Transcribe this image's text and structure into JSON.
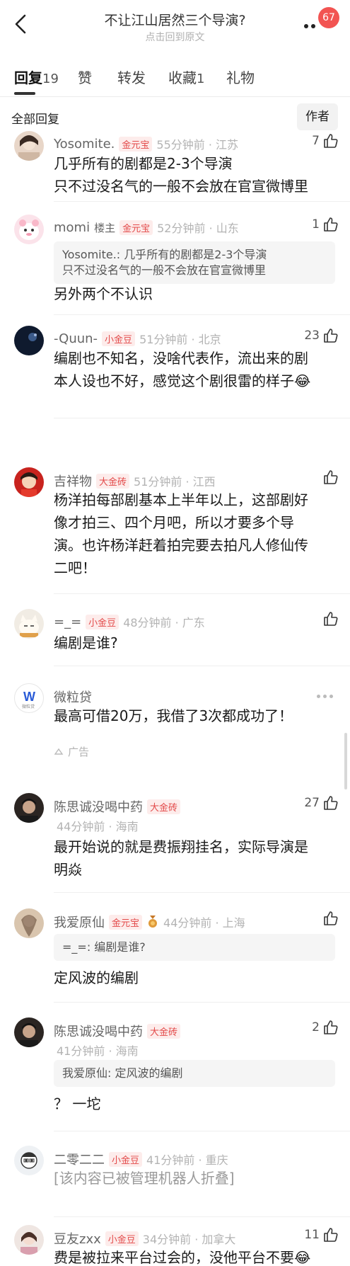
{
  "header": {
    "title": "不让江山居然三个导演?",
    "subtitle": "点击回到原文",
    "badge": "67",
    "back_icon": "chevron-left-icon",
    "more_icon": "more-dots-icon"
  },
  "tabs": [
    {
      "label": "回复",
      "count": "19"
    },
    {
      "label": "赞",
      "count": ""
    },
    {
      "label": "转发",
      "count": ""
    },
    {
      "label": "收藏",
      "count": "1"
    },
    {
      "label": "礼物",
      "count": ""
    }
  ],
  "filter": {
    "label": "全部回复",
    "author_button": "作者"
  },
  "comments": [
    {
      "user": "Yosomite.",
      "tag": "金元宝",
      "time": "55分钟前 · 江苏",
      "likes": "7",
      "text": "几乎所有的剧都是2-3个导演\n只不过没名气的一般不会放在官宣微博里"
    },
    {
      "user": "momi",
      "host": "楼主",
      "tag": "金元宝",
      "time": "52分钟前 · 山东",
      "likes": "1",
      "quote": "Yosomite.: 几乎所有的剧都是2-3个导演\n只不过没名气的一般不会放在官宣微博里",
      "text": "另外两个不认识"
    },
    {
      "user": "-Quun-",
      "tag": "小金豆",
      "time": "51分钟前 · 北京",
      "likes": "23",
      "text": "编剧也不知名，没啥代表作，流出来的剧\n本人设也不好，感觉这个剧很雷的样子😂"
    },
    {
      "user": "吉祥物",
      "tag": "大金砖",
      "time": "51分钟前 · 江西",
      "likes": "",
      "text": "杨洋拍每部剧基本上半年以上，这部剧好\n像才拍三、四个月吧，所以才要多个导\n演。也许杨洋赶着拍完要去拍凡人修仙传\n二吧！"
    },
    {
      "user": "=_=",
      "tag": "小金豆",
      "time": "48分钟前 · 广东",
      "likes": "",
      "text": "编剧是谁?"
    },
    {
      "user": "陈思诚没喝中药",
      "tag": "大金砖",
      "time": "44分钟前 · 海南",
      "likes": "27",
      "text": "最开始说的就是费振翔挂名，实际导演是\n明焱"
    },
    {
      "user": "我爱原仙",
      "tag": "金元宝",
      "time": "44分钟前 · 上海",
      "likes": "",
      "quote": "=_=: 编剧是谁?",
      "text": "定风波的编剧"
    },
    {
      "user": "陈思诚没喝中药",
      "tag": "大金砖",
      "time": "41分钟前 · 海南",
      "likes": "2",
      "quote": "我爱原仙: 定风波的编剧",
      "text": "？ 一坨"
    },
    {
      "user": "二零二二",
      "tag": "小金豆",
      "time": "41分钟前 · 重庆",
      "likes": "",
      "text": "[该内容已被管理机器人折叠]"
    },
    {
      "user": "豆友zxx",
      "tag": "小金豆",
      "time": "34分钟前 · 加拿大",
      "likes": "11",
      "text": "费是被拉来平台过会的，没他平台不要😂"
    }
  ],
  "ad": {
    "name": "微粒贷",
    "text": "最高可借20万，我借了3次都成功了！",
    "tag": "广告",
    "logo_letter": "W",
    "logo_sub": "微粒贷"
  },
  "colors": {
    "accent_red": "#e34a4a",
    "badge_red": "#f25452",
    "muted": "#b3b3b3"
  }
}
